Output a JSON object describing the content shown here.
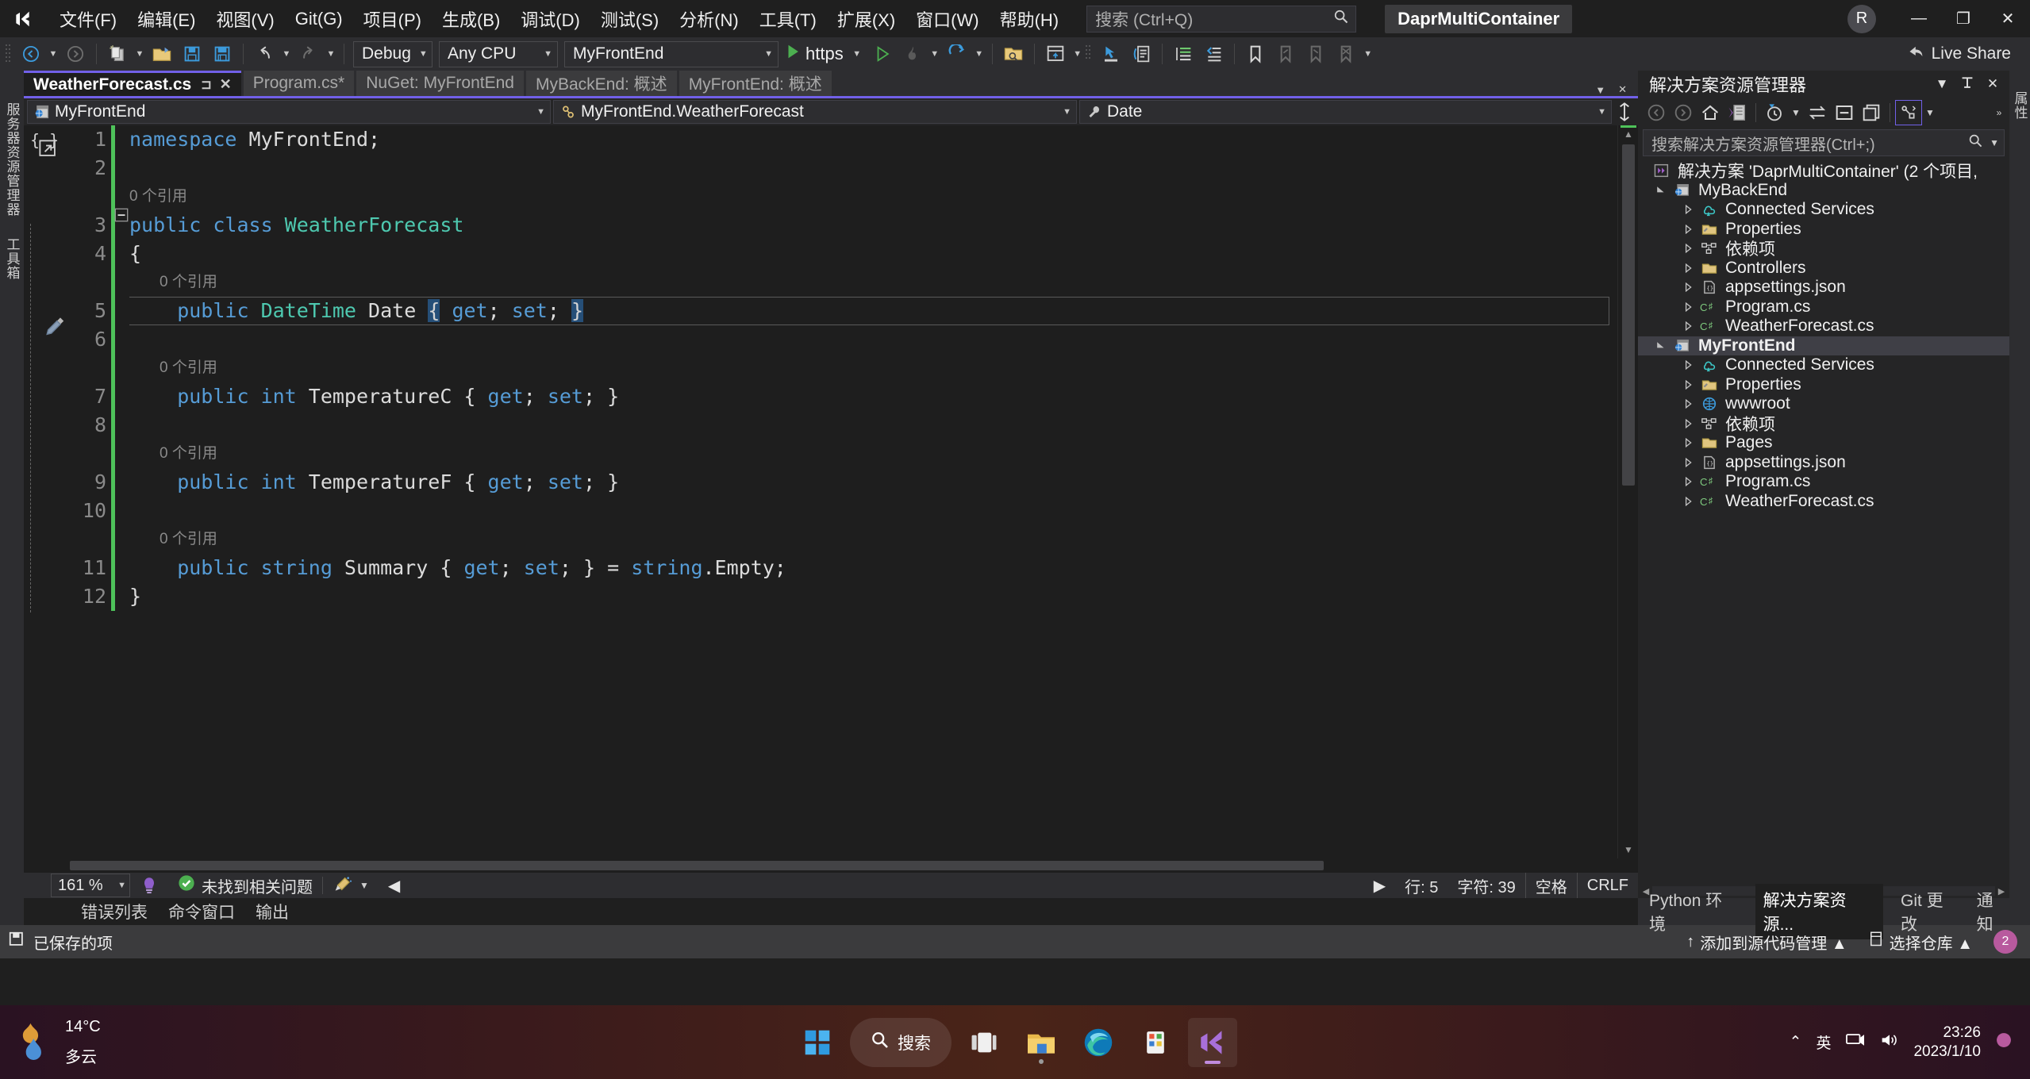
{
  "app": {
    "solution_title": "DaprMultiContainer",
    "account_initial": "R",
    "live_share": "Live Share"
  },
  "menu": {
    "items": [
      "文件(F)",
      "编辑(E)",
      "视图(V)",
      "Git(G)",
      "项目(P)",
      "生成(B)",
      "调试(D)",
      "测试(S)",
      "分析(N)",
      "工具(T)",
      "扩展(X)",
      "窗口(W)",
      "帮助(H)"
    ],
    "search_placeholder": "搜索 (Ctrl+Q)"
  },
  "window_buttons": {
    "minimize": "—",
    "maximize": "❐",
    "close": "✕"
  },
  "toolbar": {
    "config": "Debug",
    "platform": "Any CPU",
    "startup_project": "MyFrontEnd",
    "run_label": "https"
  },
  "left_rail": {
    "tabs": [
      "服务器资源管理器",
      "工具箱"
    ]
  },
  "right_rail": {
    "tabs": [
      "属性"
    ]
  },
  "tabs": [
    {
      "label": "WeatherForecast.cs",
      "active": true,
      "pin": "⊐",
      "close": "✕"
    },
    {
      "label": "Program.cs*",
      "active": false
    },
    {
      "label": "NuGet: MyFrontEnd",
      "active": false
    },
    {
      "label": "MyBackEnd: 概述",
      "active": false
    },
    {
      "label": "MyFrontEnd: 概述",
      "active": false
    }
  ],
  "navbar": {
    "project": "MyFrontEnd",
    "type": "MyFrontEnd.WeatherForecast",
    "member": "Date"
  },
  "editor": {
    "line_numbers": [
      "1",
      "2",
      "3",
      "4",
      "5",
      "6",
      "7",
      "8",
      "9",
      "10",
      "11",
      "12"
    ],
    "reference_lens": "0 个引用",
    "lines": [
      {
        "num": "1",
        "kind": "code",
        "tokens": [
          {
            "t": "namespace ",
            "c": "kw"
          },
          {
            "t": "MyFrontEnd",
            "c": "id"
          },
          {
            "t": ";",
            "c": "id"
          }
        ]
      },
      {
        "num": "2",
        "kind": "blank",
        "tokens": []
      },
      {
        "num": "",
        "kind": "lens",
        "text": "0 个引用",
        "indent": 0
      },
      {
        "num": "3",
        "kind": "code",
        "fold": true,
        "tokens": [
          {
            "t": "public class ",
            "c": "kw"
          },
          {
            "t": "WeatherForecast",
            "c": "typ"
          }
        ]
      },
      {
        "num": "4",
        "kind": "code",
        "tokens": [
          {
            "t": "{",
            "c": "id"
          }
        ]
      },
      {
        "num": "",
        "kind": "lens",
        "text": "0 个引用",
        "indent": 1
      },
      {
        "num": "5",
        "kind": "code",
        "current": true,
        "tokens": [
          {
            "t": "    public ",
            "c": "kw"
          },
          {
            "t": "DateTime",
            "c": "typ"
          },
          {
            "t": " Date ",
            "c": "id"
          },
          {
            "t": "{",
            "c": "hl"
          },
          {
            "t": " ",
            "c": "id"
          },
          {
            "t": "get",
            "c": "acc"
          },
          {
            "t": "; ",
            "c": "id"
          },
          {
            "t": "set",
            "c": "acc"
          },
          {
            "t": "; ",
            "c": "id"
          },
          {
            "t": "}",
            "c": "hl"
          }
        ]
      },
      {
        "num": "6",
        "kind": "blank",
        "tokens": []
      },
      {
        "num": "",
        "kind": "lens",
        "text": "0 个引用",
        "indent": 1
      },
      {
        "num": "7",
        "kind": "code",
        "tokens": [
          {
            "t": "    public int",
            "c": "kw"
          },
          {
            "t": " TemperatureC ",
            "c": "id"
          },
          {
            "t": "{ ",
            "c": "id"
          },
          {
            "t": "get",
            "c": "acc"
          },
          {
            "t": "; ",
            "c": "id"
          },
          {
            "t": "set",
            "c": "acc"
          },
          {
            "t": "; }",
            "c": "id"
          }
        ]
      },
      {
        "num": "8",
        "kind": "blank",
        "tokens": []
      },
      {
        "num": "",
        "kind": "lens",
        "text": "0 个引用",
        "indent": 1
      },
      {
        "num": "9",
        "kind": "code",
        "tokens": [
          {
            "t": "    public int",
            "c": "kw"
          },
          {
            "t": " TemperatureF ",
            "c": "id"
          },
          {
            "t": "{ ",
            "c": "id"
          },
          {
            "t": "get",
            "c": "acc"
          },
          {
            "t": "; ",
            "c": "id"
          },
          {
            "t": "set",
            "c": "acc"
          },
          {
            "t": "; }",
            "c": "id"
          }
        ]
      },
      {
        "num": "10",
        "kind": "blank",
        "tokens": []
      },
      {
        "num": "",
        "kind": "lens",
        "text": "0 个引用",
        "indent": 1
      },
      {
        "num": "11",
        "kind": "code",
        "tokens": [
          {
            "t": "    public string",
            "c": "kw"
          },
          {
            "t": " Summary ",
            "c": "id"
          },
          {
            "t": "{ ",
            "c": "id"
          },
          {
            "t": "get",
            "c": "acc"
          },
          {
            "t": "; ",
            "c": "id"
          },
          {
            "t": "set",
            "c": "acc"
          },
          {
            "t": "; } = ",
            "c": "id"
          },
          {
            "t": "string",
            "c": "kw"
          },
          {
            "t": ".Empty;",
            "c": "id"
          }
        ]
      },
      {
        "num": "12",
        "kind": "code",
        "tokens": [
          {
            "t": "}",
            "c": "id"
          }
        ]
      }
    ],
    "code_text": [
      "namespace MyFrontEnd;",
      "",
      "0 个引用",
      "public class WeatherForecast",
      "{",
      "    0 个引用",
      "    public DateTime Date { get; set; }",
      "",
      "    0 个引用",
      "    public int TemperatureC { get; set; }",
      "",
      "    0 个引用",
      "    public int TemperatureF { get; set; }",
      "",
      "    0 个引用",
      "    public string Summary { get; set; } = string.Empty;",
      "}"
    ]
  },
  "editor_status": {
    "zoom": "161 %",
    "problems": "未找到相关问题",
    "line": "行: 5",
    "col": "字符: 39",
    "indent": "空格",
    "eol": "CRLF"
  },
  "dock_tabs": [
    "错误列表",
    "命令窗口",
    "输出"
  ],
  "solution_explorer": {
    "title": "解决方案资源管理器",
    "search_placeholder": "搜索解决方案资源管理器(Ctrl+;)",
    "tree": [
      {
        "depth": 0,
        "label": "解决方案 'DaprMultiContainer' (2 个项目,",
        "icon": "solution-icon",
        "twisty": "",
        "selected": false
      },
      {
        "depth": 1,
        "label": "MyBackEnd",
        "icon": "web-project-icon",
        "twisty": "▲",
        "selected": false,
        "expanded": true
      },
      {
        "depth": 2,
        "label": "Connected Services",
        "icon": "connected-services-icon",
        "twisty": "▷",
        "selected": false
      },
      {
        "depth": 2,
        "label": "Properties",
        "icon": "properties-folder-icon",
        "twisty": "▷",
        "selected": false
      },
      {
        "depth": 2,
        "label": "依赖项",
        "icon": "dependencies-icon",
        "twisty": "▷",
        "selected": false
      },
      {
        "depth": 2,
        "label": "Controllers",
        "icon": "folder-icon",
        "twisty": "▷",
        "selected": false
      },
      {
        "depth": 2,
        "label": "appsettings.json",
        "icon": "json-file-icon",
        "twisty": "▷",
        "selected": false
      },
      {
        "depth": 2,
        "label": "Program.cs",
        "icon": "csharp-file-icon",
        "twisty": "▷",
        "selected": false
      },
      {
        "depth": 2,
        "label": "WeatherForecast.cs",
        "icon": "csharp-file-icon",
        "twisty": "▷",
        "selected": false
      },
      {
        "depth": 1,
        "label": "MyFrontEnd",
        "icon": "web-project-icon",
        "twisty": "▲",
        "selected": true,
        "expanded": true
      },
      {
        "depth": 2,
        "label": "Connected Services",
        "icon": "connected-services-icon",
        "twisty": "▷",
        "selected": false
      },
      {
        "depth": 2,
        "label": "Properties",
        "icon": "properties-folder-icon",
        "twisty": "▷",
        "selected": false
      },
      {
        "depth": 2,
        "label": "wwwroot",
        "icon": "globe-icon",
        "twisty": "▷",
        "selected": false
      },
      {
        "depth": 2,
        "label": "依赖项",
        "icon": "dependencies-icon",
        "twisty": "▷",
        "selected": false
      },
      {
        "depth": 2,
        "label": "Pages",
        "icon": "folder-icon",
        "twisty": "▷",
        "selected": false
      },
      {
        "depth": 2,
        "label": "appsettings.json",
        "icon": "json-file-icon",
        "twisty": "▷",
        "selected": false
      },
      {
        "depth": 2,
        "label": "Program.cs",
        "icon": "csharp-file-icon",
        "twisty": "▷",
        "selected": false
      },
      {
        "depth": 2,
        "label": "WeatherForecast.cs",
        "icon": "csharp-file-icon",
        "twisty": "▷",
        "selected": false
      }
    ]
  },
  "bottom_docks": [
    "Python 环境",
    "解决方案资源...",
    "Git 更改",
    "通知"
  ],
  "statusbar": {
    "saved": "已保存的项",
    "source_control": "添加到源代码管理 ▲",
    "repo": "选择仓库 ▲",
    "notif_count": "2"
  },
  "taskbar": {
    "temperature": "14°C",
    "condition": "多云",
    "search_label": "搜索",
    "ime": "英",
    "time": "23:26",
    "date": "2023/1/10",
    "apps": [
      "start-button",
      "search-pill",
      "task-view",
      "file-explorer",
      "edge-browser",
      "store",
      "visual-studio"
    ]
  },
  "colors": {
    "accent_purple": "#7160e8",
    "keyword_blue": "#569cd6",
    "type_teal": "#4ec9b0",
    "changebar_green": "#4ec25a",
    "status_grey": "#3b3b3d"
  }
}
